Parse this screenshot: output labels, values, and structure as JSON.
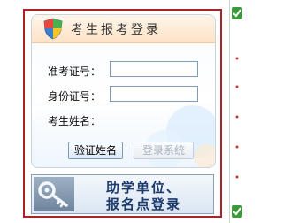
{
  "login": {
    "title": "考生报考登录",
    "fields": [
      {
        "label": "准考证号：",
        "value": "",
        "placeholder": ""
      },
      {
        "label": "身份证号：",
        "value": "",
        "placeholder": ""
      },
      {
        "label": "考生姓名：",
        "value": ""
      }
    ],
    "verify_button": "验证姓名",
    "login_button": "登录系统"
  },
  "assist": {
    "line1": "助学单位、",
    "line2": "报名点登录"
  },
  "colors": {
    "frame_border": "#a72528",
    "header_bg": "#fde2c6",
    "disabled_text": "#a7b3bf"
  },
  "icons": [
    "shield-icon",
    "key-icon",
    "check-icon"
  ]
}
